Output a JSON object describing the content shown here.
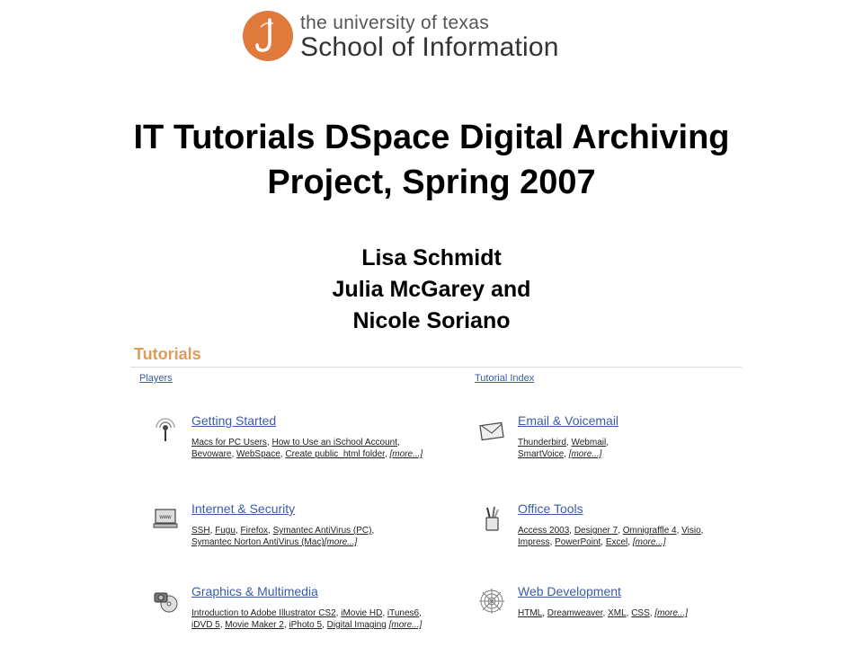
{
  "logo": {
    "line1": "the university of texas",
    "line2": "School of Information"
  },
  "title": {
    "line1": "IT Tutorials DSpace Digital Archiving",
    "line2": "Project, Spring 2007"
  },
  "authors": [
    "Lisa Schmidt",
    "Julia McGarey and",
    "Nicole Soriano"
  ],
  "screenshot": {
    "heading": "Tutorials",
    "players_link": "Players",
    "index_link": "Tutorial Index",
    "categories": [
      {
        "heading": "Getting Started",
        "icon": "podcast-icon",
        "items": [
          "Macs for PC Users",
          "How to Use an iSchool Account",
          "Bevoware",
          "WebSpace",
          "Create public_html folder"
        ],
        "more": "[more...]"
      },
      {
        "heading": "Email & Voicemail",
        "icon": "envelope-icon",
        "items": [
          "Thunderbird",
          "Webmail",
          "SmartVoice"
        ],
        "more": "[more...]"
      },
      {
        "heading": "Internet & Security",
        "icon": "computer-www-icon",
        "items": [
          "SSH",
          "Fugu",
          "Firefox",
          "Symantec AntiVirus (PC)",
          "Symantec Norton AntiVirus (Mac)"
        ],
        "more": "[more...]"
      },
      {
        "heading": "Office Tools",
        "icon": "pencil-cup-icon",
        "items": [
          "Access 2003",
          "Designer 7",
          "Omnigraffle 4",
          "Visio",
          "Impress",
          "PowerPoint",
          "Excel"
        ],
        "more": "[more...]"
      },
      {
        "heading": "Graphics & Multimedia",
        "icon": "camera-disc-icon",
        "items": [
          "Introduction to Adobe Illustrator CS2",
          "iMovie HD",
          "iTunes6",
          "iDVD 5",
          "Movie Maker 2",
          "iPhoto 5",
          "Digital Imaging"
        ],
        "more": "[more...]"
      },
      {
        "heading": "Web Development",
        "icon": "spider-web-icon",
        "items": [
          "HTML",
          "Dreamweaver",
          "XML",
          "CSS"
        ],
        "more": "[more...]"
      }
    ]
  },
  "colors": {
    "logo_orange": "#e07a3c",
    "tutorials_heading": "#e39a57",
    "link_blue": "#3a5ba8"
  }
}
